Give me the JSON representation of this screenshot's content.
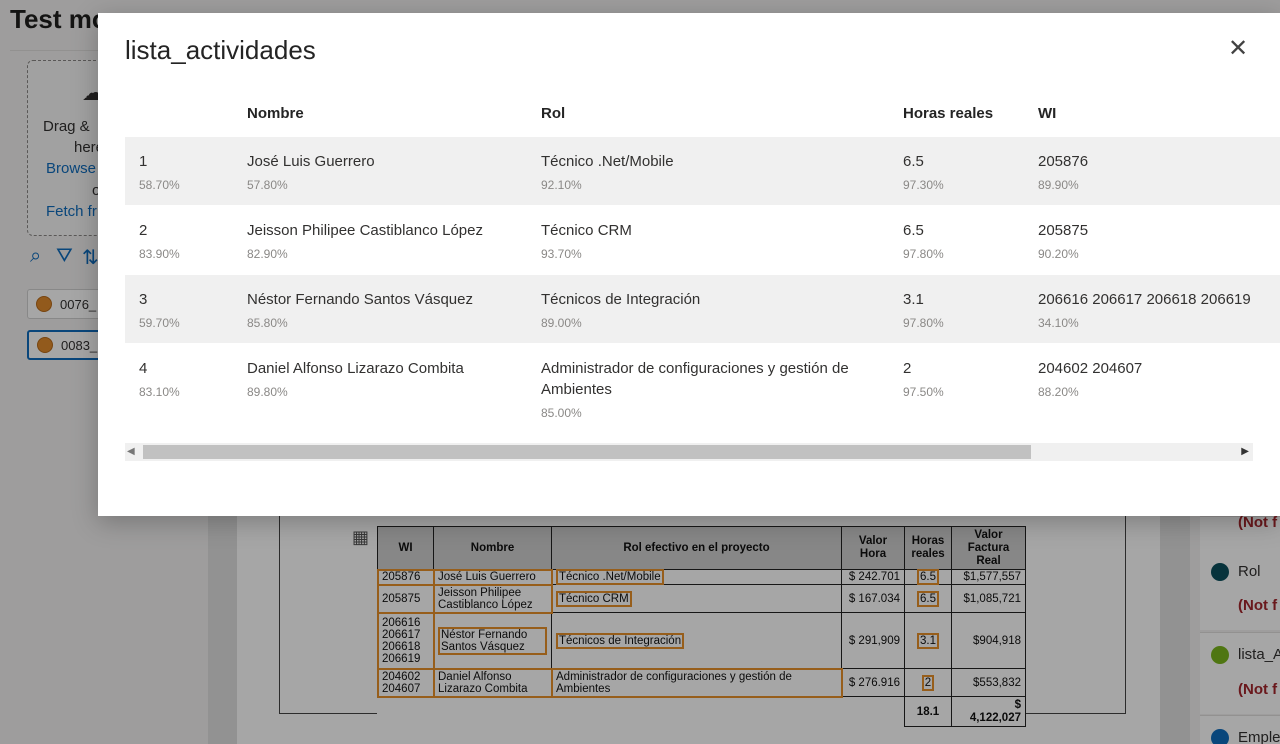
{
  "app": {
    "title": "Test mo",
    "dropzone": {
      "drag_text": "Drag &",
      "here_text": "here",
      "browse_link": "Browse",
      "or_text": "o",
      "fetch_link": "Fetch fr"
    },
    "documents": [
      {
        "name": "0076_",
        "selected": false
      },
      {
        "name": "0083_",
        "selected": true
      }
    ]
  },
  "modal": {
    "title": "lista_actividades",
    "columns": [
      "Nombre",
      "Rol",
      "Horas reales",
      "WI"
    ],
    "rows": [
      {
        "index": "1",
        "index_conf": "58.70%",
        "nombre": "José Luis Guerrero",
        "nombre_conf": "57.80%",
        "rol": "Técnico .Net/Mobile",
        "rol_conf": "92.10%",
        "horas": "6.5",
        "horas_conf": "97.30%",
        "wi": "205876",
        "wi_conf": "89.90%"
      },
      {
        "index": "2",
        "index_conf": "83.90%",
        "nombre": "Jeisson Philipee Castiblanco López",
        "nombre_conf": "82.90%",
        "rol": "Técnico CRM",
        "rol_conf": "93.70%",
        "horas": "6.5",
        "horas_conf": "97.80%",
        "wi": "205875",
        "wi_conf": "90.20%"
      },
      {
        "index": "3",
        "index_conf": "59.70%",
        "nombre": "Néstor Fernando Santos Vásquez",
        "nombre_conf": "85.80%",
        "rol": "Técnicos de Integración",
        "rol_conf": "89.00%",
        "horas": "3.1",
        "horas_conf": "97.80%",
        "wi": "206616 206617 206618 206619",
        "wi_conf": "34.10%"
      },
      {
        "index": "4",
        "index_conf": "83.10%",
        "nombre": "Daniel Alfonso Lizarazo Combita",
        "nombre_conf": "89.80%",
        "rol": "Administrador de configuraciones y gestión de Ambientes",
        "rol_conf": "85.00%",
        "horas": "2",
        "horas_conf": "97.50%",
        "wi": "204602 204607",
        "wi_conf": "88.20%"
      }
    ]
  },
  "scan_table": {
    "headers": [
      "WI",
      "Nombre",
      "Rol efectivo en el proyecto",
      "Valor Hora",
      "Horas reales",
      "Valor Factura Real"
    ],
    "rows": [
      {
        "wi": "205876",
        "nombre": "José Luis Guerrero",
        "rol": "Técnico .Net/Mobile",
        "valor_hora": "$ 242.701",
        "horas": "6.5",
        "factura": "$1,577,557"
      },
      {
        "wi": "205875",
        "nombre": "Jeisson Philipee Castiblanco López",
        "rol": "Técnico CRM",
        "valor_hora": "$ 167.034",
        "horas": "6.5",
        "factura": "$1,085,721"
      },
      {
        "wi": "206616 206617 206618 206619",
        "nombre": "Néstor Fernando Santos Vásquez",
        "rol": "Técnicos de Integración",
        "valor_hora": "$ 291,909",
        "horas": "3.1",
        "factura": "$904,918"
      },
      {
        "wi": "204602 204607",
        "nombre": "Daniel Alfonso Lizarazo Combita",
        "rol": "Administrador de configuraciones y gestión de Ambientes",
        "valor_hora": "$ 276.916",
        "horas": "2",
        "factura": "$553,832"
      }
    ],
    "total_horas": "18.1",
    "total_currency": "$",
    "total_factura": "4,122,027"
  },
  "right_panel": {
    "items": [
      {
        "label": "",
        "status": "(Not f",
        "color": "#0f6cbd"
      },
      {
        "label": "Rol",
        "status": "(Not f",
        "color": "#0b4f5c"
      },
      {
        "label": "lista_A",
        "status": "(Not f",
        "color": "#7ab51d"
      },
      {
        "label": "Emple",
        "status": "",
        "color": "#0f6cbd"
      }
    ]
  }
}
